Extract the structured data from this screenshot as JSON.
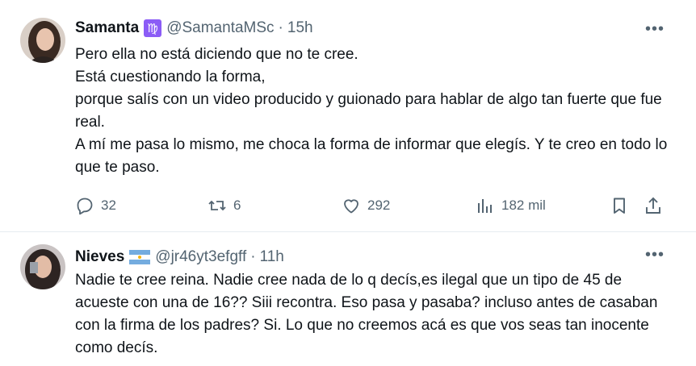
{
  "tweets": [
    {
      "name": "Samanta",
      "badge": "♍",
      "handle": "@SamantaMSc",
      "separator": "·",
      "time": "15h",
      "more": "•••",
      "lines": [
        "Pero ella no está diciendo que no te cree.",
        "Está cuestionando la forma,",
        "porque salís con un video producido y guionado para hablar de algo tan fuerte que fue real.",
        "A mí me pasa lo mismo, me choca la forma de informar que elegís. Y te creo en todo lo que te paso."
      ],
      "actions": {
        "replies": "32",
        "retweets": "6",
        "likes": "292",
        "views": "182 mil"
      },
      "colors": {
        "badge_bg": "#8b5cf6"
      }
    },
    {
      "name": "Nieves",
      "badge": "argentina-flag",
      "handle": "@jr46yt3efgff",
      "separator": "·",
      "time": "11h",
      "more": "•••",
      "lines": [
        "Nadie te cree reina. Nadie cree nada de lo q decís,es ilegal que un tipo de 45 de acueste con una de 16?? Siii recontra. Eso pasa y pasaba? incluso antes de casaban con la firma de los padres? Si. Lo que no creemos acá es que vos seas tan inocente como decís."
      ]
    }
  ],
  "icons": {
    "reply": "reply-icon",
    "retweet": "retweet-icon",
    "like": "heart-icon",
    "views": "views-icon",
    "bookmark": "bookmark-icon",
    "share": "share-icon"
  }
}
